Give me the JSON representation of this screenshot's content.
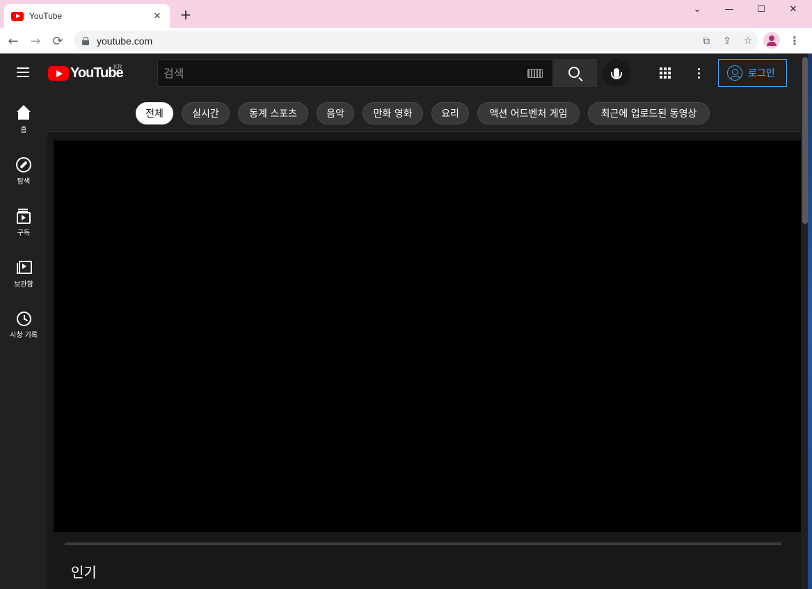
{
  "browser": {
    "tab_title": "YouTube",
    "tab_close_glyph": "✕",
    "new_tab_glyph": "+",
    "url": "youtube.com",
    "window_controls": [
      "⌄",
      "—",
      "☐",
      "✕"
    ],
    "nav": {
      "back": "←",
      "forward": "→",
      "reload": "⟳"
    },
    "omnibox_icons": [
      "⧉",
      "⇪",
      "☆"
    ],
    "menu_glyph": "⋮"
  },
  "youtube": {
    "logo_text": "YouTube",
    "country_code": "KR",
    "search_placeholder": "검색",
    "signin_label": "로그인",
    "guide": [
      {
        "label": "홈",
        "icon": "home-icon"
      },
      {
        "label": "탐색",
        "icon": "explore-icon"
      },
      {
        "label": "구독",
        "icon": "subscriptions-icon"
      },
      {
        "label": "보관함",
        "icon": "library-icon"
      },
      {
        "label": "시청 기록",
        "icon": "history-icon"
      }
    ],
    "chips": [
      {
        "label": "전체",
        "active": true
      },
      {
        "label": "실시간"
      },
      {
        "label": "동계 스포츠"
      },
      {
        "label": "음악"
      },
      {
        "label": "만화 영화"
      },
      {
        "label": "요리"
      },
      {
        "label": "액션 어드벤처 게임"
      },
      {
        "label": "최근에 업로드된 동영상"
      }
    ],
    "section_title": "인기"
  },
  "colors": {
    "masthead_bg": "#212121",
    "page_bg": "#181818",
    "accent_blue": "#3ea6ff",
    "brand_red": "#ff0000",
    "browser_frame": "#f6d3e4"
  }
}
